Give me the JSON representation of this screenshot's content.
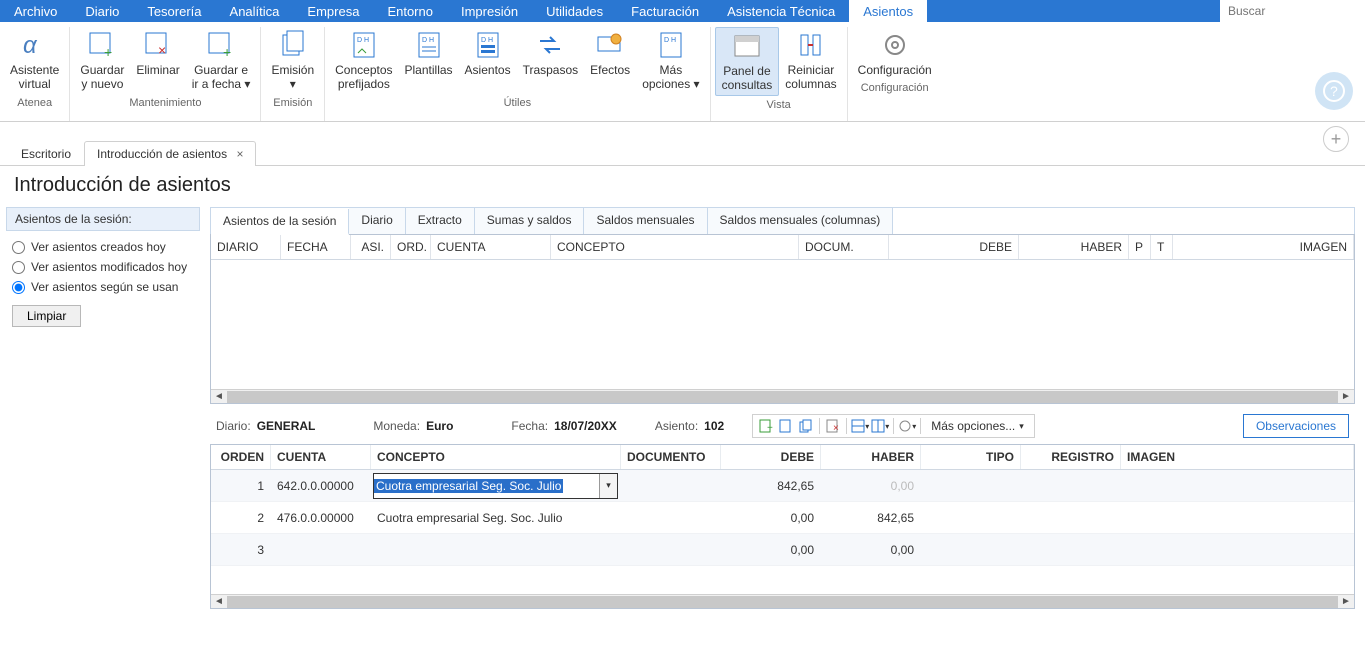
{
  "menu": {
    "items": [
      "Archivo",
      "Diario",
      "Tesorería",
      "Analítica",
      "Empresa",
      "Entorno",
      "Impresión",
      "Utilidades",
      "Facturación",
      "Asistencia Técnica",
      "Asientos"
    ],
    "active": 10,
    "search_placeholder": "Buscar"
  },
  "ribbon": {
    "groups": [
      {
        "label": "Atenea",
        "buttons": [
          {
            "l1": "Asistente",
            "l2": "virtual"
          }
        ]
      },
      {
        "label": "Mantenimiento",
        "buttons": [
          {
            "l1": "Guardar",
            "l2": "y nuevo"
          },
          {
            "l1": "Eliminar",
            "l2": ""
          },
          {
            "l1": "Guardar e",
            "l2": "ir a fecha ▾"
          }
        ]
      },
      {
        "label": "Emisión",
        "buttons": [
          {
            "l1": "Emisión",
            "l2": "▾"
          }
        ]
      },
      {
        "label": "Útiles",
        "buttons": [
          {
            "l1": "Conceptos",
            "l2": "prefijados"
          },
          {
            "l1": "Plantillas",
            "l2": ""
          },
          {
            "l1": "Asientos",
            "l2": ""
          },
          {
            "l1": "Traspasos",
            "l2": ""
          },
          {
            "l1": "Efectos",
            "l2": ""
          },
          {
            "l1": "Más",
            "l2": "opciones ▾"
          }
        ]
      },
      {
        "label": "Vista",
        "buttons": [
          {
            "l1": "Panel de",
            "l2": "consultas",
            "active": true
          },
          {
            "l1": "Reiniciar",
            "l2": "columnas"
          }
        ]
      },
      {
        "label": "Configuración",
        "buttons": [
          {
            "l1": "Configuración",
            "l2": ""
          }
        ]
      }
    ]
  },
  "doc_tabs": [
    {
      "label": "Escritorio",
      "active": false,
      "closable": false
    },
    {
      "label": "Introducción de asientos",
      "active": true,
      "closable": true
    }
  ],
  "page_title": "Introducción de asientos",
  "sidebar": {
    "header": "Asientos de la sesión:",
    "radios": [
      {
        "label": "Ver asientos creados hoy",
        "checked": false
      },
      {
        "label": "Ver asientos modificados hoy",
        "checked": false
      },
      {
        "label": "Ver asientos según se usan",
        "checked": true
      }
    ],
    "clear_btn": "Limpiar"
  },
  "sub_tabs": [
    "Asientos de la sesión",
    "Diario",
    "Extracto",
    "Sumas y saldos",
    "Saldos mensuales",
    "Saldos mensuales (columnas)"
  ],
  "top_table": {
    "columns": [
      "DIARIO",
      "FECHA",
      "ASI.",
      "ORD.",
      "CUENTA",
      "CONCEPTO",
      "DOCUM.",
      "DEBE",
      "HABER",
      "P",
      "T",
      "IMAGEN"
    ]
  },
  "entry_bar": {
    "diario_lbl": "Diario:",
    "diario_val": "GENERAL",
    "moneda_lbl": "Moneda:",
    "moneda_val": "Euro",
    "fecha_lbl": "Fecha:",
    "fecha_val": "18/07/20XX",
    "asiento_lbl": "Asiento:",
    "asiento_val": "102",
    "more": "Más opciones...",
    "obs": "Observaciones"
  },
  "low_table": {
    "columns": [
      "ORDEN",
      "CUENTA",
      "CONCEPTO",
      "DOCUMENTO",
      "DEBE",
      "HABER",
      "TIPO",
      "REGISTRO",
      "IMAGEN"
    ],
    "rows": [
      {
        "orden": "1",
        "cuenta": "642.0.0.00000",
        "concepto": "Cuotra empresarial Seg. Soc. Julio",
        "documento": "",
        "debe": "842,65",
        "haber": "0,00",
        "haber_dim": true,
        "editing": true
      },
      {
        "orden": "2",
        "cuenta": "476.0.0.00000",
        "concepto": "Cuotra empresarial Seg. Soc. Julio",
        "documento": "",
        "debe": "0,00",
        "haber": "842,65"
      },
      {
        "orden": "3",
        "cuenta": "",
        "concepto": "",
        "documento": "",
        "debe": "0,00",
        "haber": "0,00"
      }
    ]
  }
}
